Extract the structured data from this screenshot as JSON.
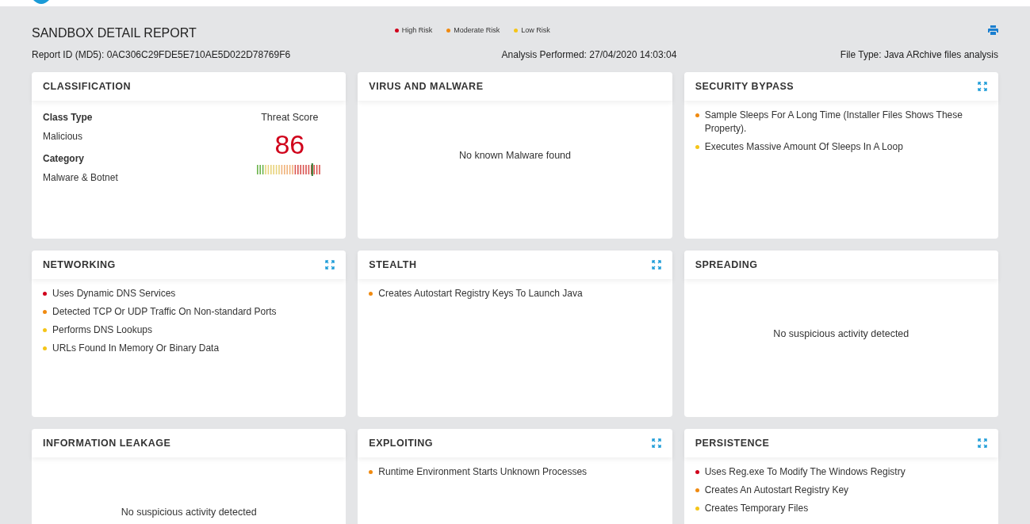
{
  "report": {
    "title": "SANDBOX DETAIL REPORT",
    "report_id": "Report ID (MD5): 0AC306C29FDE5E710AE5D022D78769F6",
    "analysis": "Analysis Performed: 27/04/2020 14:03:04",
    "file_type": "File Type: Java ARchive files analysis"
  },
  "legend": [
    {
      "label": "High Risk",
      "color": "#d0021b"
    },
    {
      "label": "Moderate Risk",
      "color": "#f08a10"
    },
    {
      "label": "Low Risk",
      "color": "#f5c518"
    }
  ],
  "cards": [
    {
      "kind": "classification",
      "title": "CLASSIFICATION",
      "expandable": false,
      "class_type_label": "Class Type",
      "class_type": "Malicious",
      "category_label": "Category",
      "category": "Malware & Botnet",
      "score_label": "Threat Score",
      "score": "86",
      "level": 0.86
    },
    {
      "kind": "empty",
      "title": "VIRUS AND MALWARE",
      "expandable": false,
      "message": "No known Malware found"
    },
    {
      "kind": "list",
      "title": "SECURITY BYPASS",
      "expandable": true,
      "items": [
        {
          "text": "Sample Sleeps For A Long Time (Installer Files Shows These Property).",
          "color": "#f08a10"
        },
        {
          "text": "Executes Massive Amount Of Sleeps In A Loop",
          "color": "#f5c518"
        }
      ]
    },
    {
      "kind": "list",
      "title": "NETWORKING",
      "expandable": true,
      "items": [
        {
          "text": "Uses Dynamic DNS Services",
          "color": "#d0021b"
        },
        {
          "text": "Detected TCP Or UDP Traffic On Non-standard Ports",
          "color": "#f08a10"
        },
        {
          "text": "Performs DNS Lookups",
          "color": "#f5c518"
        },
        {
          "text": "URLs Found In Memory Or Binary Data",
          "color": "#f5c518"
        }
      ]
    },
    {
      "kind": "list",
      "title": "STEALTH",
      "expandable": true,
      "items": [
        {
          "text": "Creates Autostart Registry Keys To Launch Java",
          "color": "#f08a10"
        }
      ]
    },
    {
      "kind": "empty",
      "title": "SPREADING",
      "expandable": false,
      "message": "No suspicious activity detected"
    },
    {
      "kind": "empty",
      "title": "INFORMATION LEAKAGE",
      "expandable": false,
      "message": "No suspicious activity detected"
    },
    {
      "kind": "list",
      "title": "EXPLOITING",
      "expandable": true,
      "items": [
        {
          "text": "Runtime Environment Starts Unknown Processes",
          "color": "#f08a10"
        }
      ]
    },
    {
      "kind": "list",
      "title": "PERSISTENCE",
      "expandable": true,
      "items": [
        {
          "text": "Uses Reg.exe To Modify The Windows Registry",
          "color": "#d0021b"
        },
        {
          "text": "Creates An Autostart Registry Key",
          "color": "#f08a10"
        },
        {
          "text": "Creates Temporary Files",
          "color": "#f5c518"
        }
      ]
    }
  ]
}
